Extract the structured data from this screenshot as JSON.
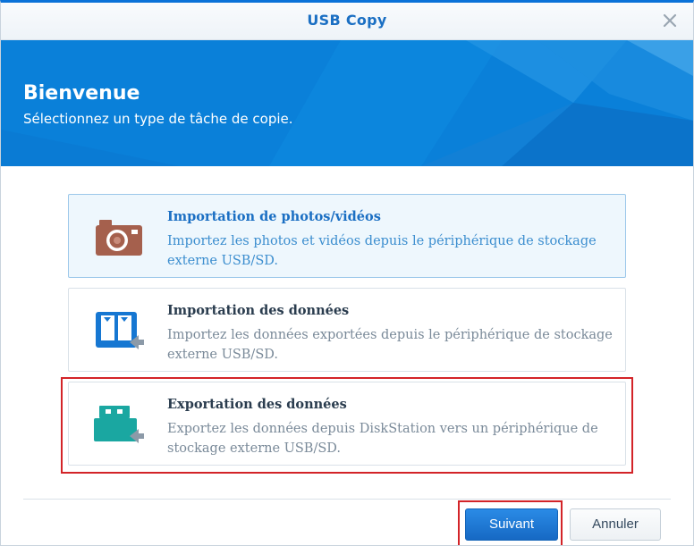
{
  "window": {
    "title": "USB Copy"
  },
  "banner": {
    "heading": "Bienvenue",
    "subtitle": "Sélectionnez un type de tâche de copie."
  },
  "options": [
    {
      "title": "Importation de photos/vidéos",
      "description": "Importez les photos et vidéos depuis le périphérique de stockage externe USB/SD.",
      "icon": "camera-icon",
      "selected": true
    },
    {
      "title": "Importation des données",
      "description": "Importez les données exportées depuis le périphérique de stockage externe USB/SD.",
      "icon": "import-data-icon",
      "selected": false
    },
    {
      "title": "Exportation des données",
      "description": "Exportez les données depuis DiskStation vers un périphérique de stockage externe USB/SD.",
      "icon": "usb-export-icon",
      "selected": false
    }
  ],
  "buttons": {
    "next": "Suivant",
    "cancel": "Annuler"
  },
  "colors": {
    "accent": "#0b72d8",
    "banner": "#0a7fd8",
    "highlight": "#d32428",
    "camera": "#a5604d",
    "import_icon": "#1677d2",
    "usb_icon": "#1aa7a1"
  }
}
